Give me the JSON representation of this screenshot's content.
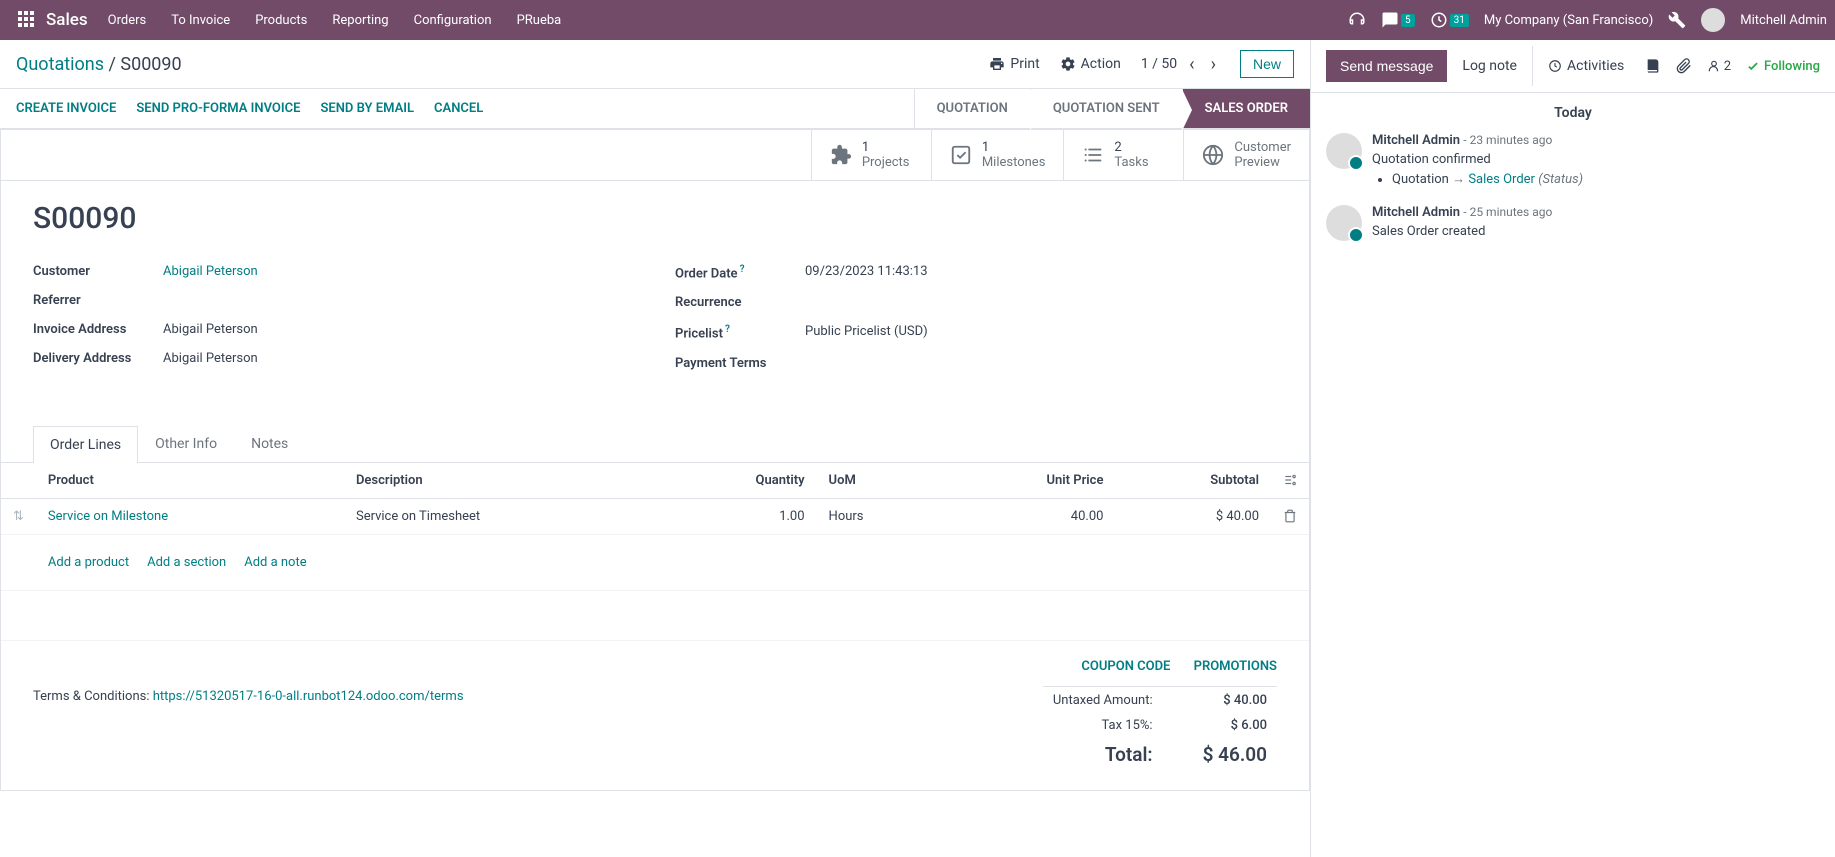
{
  "nav": {
    "brand": "Sales",
    "menu": [
      "Orders",
      "To Invoice",
      "Products",
      "Reporting",
      "Configuration",
      "PRueba"
    ],
    "chat_badge": "5",
    "clock_badge": "31",
    "company": "My Company (San Francisco)",
    "username": "Mitchell Admin"
  },
  "cp": {
    "breadcrumb_root": "Quotations",
    "breadcrumb_current": "S00090",
    "print": "Print",
    "action": "Action",
    "pager": "1 / 50",
    "new": "New"
  },
  "actions": {
    "create_invoice": "CREATE INVOICE",
    "send_proforma": "SEND PRO-FORMA INVOICE",
    "send_email": "SEND BY EMAIL",
    "cancel": "CANCEL"
  },
  "status_steps": {
    "quotation": "QUOTATION",
    "quotation_sent": "QUOTATION SENT",
    "sales_order": "SALES ORDER"
  },
  "stats": {
    "projects_n": "1",
    "projects_l": "Projects",
    "milestones_n": "1",
    "milestones_l": "Milestones",
    "tasks_n": "2",
    "tasks_l": "Tasks",
    "preview_l1": "Customer",
    "preview_l2": "Preview"
  },
  "order": {
    "name": "S00090",
    "customer_l": "Customer",
    "customer_v": "Abigail Peterson",
    "referrer_l": "Referrer",
    "referrer_v": "",
    "invoice_addr_l": "Invoice Address",
    "invoice_addr_v": "Abigail Peterson",
    "delivery_addr_l": "Delivery Address",
    "delivery_addr_v": "Abigail Peterson",
    "order_date_l": "Order Date",
    "order_date_v": "09/23/2023 11:43:13",
    "recurrence_l": "Recurrence",
    "recurrence_v": "",
    "pricelist_l": "Pricelist",
    "pricelist_v": "Public Pricelist (USD)",
    "payment_terms_l": "Payment Terms",
    "payment_terms_v": ""
  },
  "tabs": {
    "order_lines": "Order Lines",
    "other_info": "Other Info",
    "notes": "Notes"
  },
  "columns": {
    "product": "Product",
    "description": "Description",
    "quantity": "Quantity",
    "uom": "UoM",
    "unit_price": "Unit Price",
    "subtotal": "Subtotal"
  },
  "line": {
    "product": "Service on Milestone",
    "description": "Service on Timesheet",
    "quantity": "1.00",
    "uom": "Hours",
    "unit_price": "40.00",
    "subtotal": "$ 40.00"
  },
  "add": {
    "product": "Add a product",
    "section": "Add a section",
    "note": "Add a note"
  },
  "promo": {
    "coupon": "COUPON CODE",
    "promotions": "PROMOTIONS"
  },
  "totals": {
    "untaxed_l": "Untaxed Amount:",
    "untaxed_v": "$ 40.00",
    "tax_l": "Tax 15%:",
    "tax_v": "$ 6.00",
    "total_l": "Total:",
    "total_v": "$ 46.00"
  },
  "terms": {
    "label": "Terms & Conditions: ",
    "link": "https://51320517-16-0-all.runbot124.odoo.com/terms"
  },
  "chatter": {
    "send": "Send message",
    "log": "Log note",
    "activities": "Activities",
    "followers": "2",
    "following": "Following",
    "today": "Today"
  },
  "messages": [
    {
      "author": "Mitchell Admin",
      "time": "- 23 minutes ago",
      "body": "Quotation confirmed",
      "track_from": "Quotation",
      "track_to": "Sales Order",
      "track_status": "(Status)"
    },
    {
      "author": "Mitchell Admin",
      "time": "- 25 minutes ago",
      "body": "Sales Order created"
    }
  ]
}
